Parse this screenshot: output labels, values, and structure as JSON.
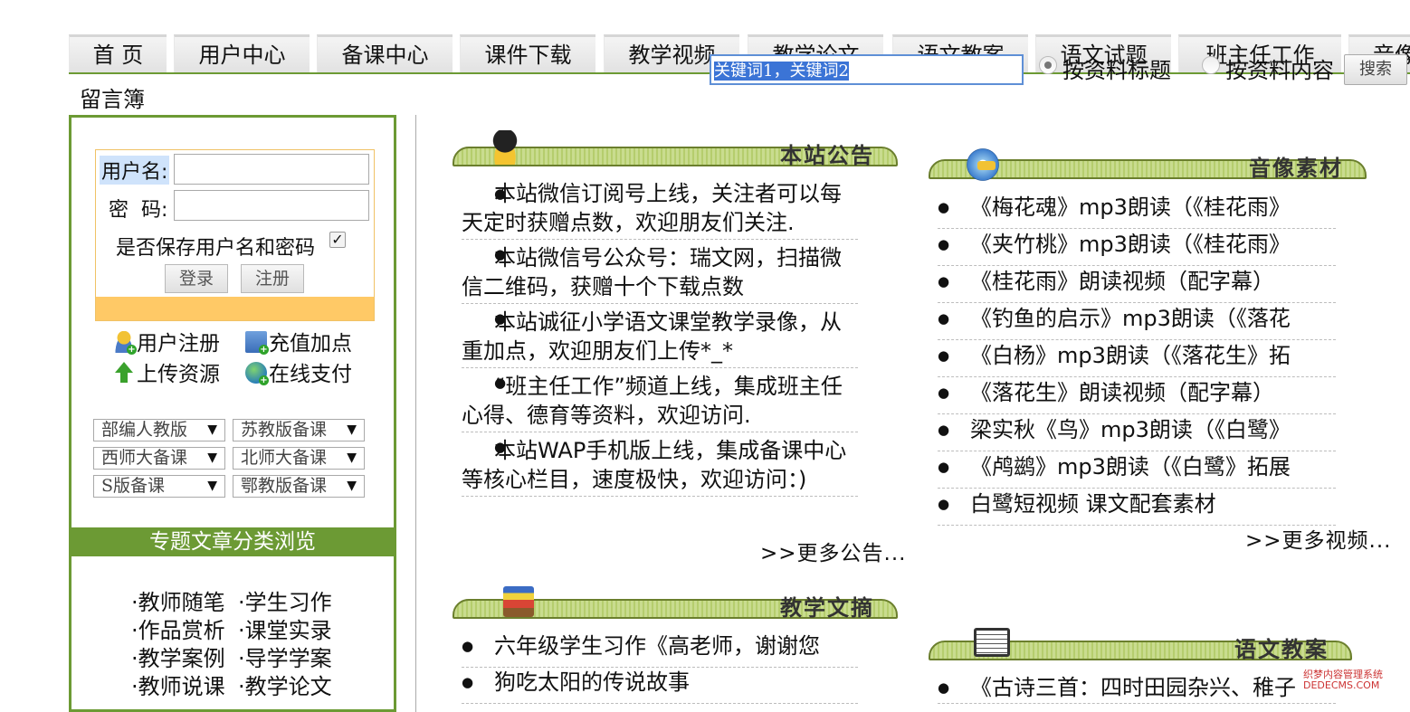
{
  "nav": {
    "tabs": [
      "首 页",
      "用户中心",
      "备课中心",
      "课件下载",
      "教学视频",
      "教学论文",
      "语文教案",
      "语文试题",
      "班主任工作",
      "音像"
    ],
    "guestbook": "留言簿"
  },
  "search": {
    "value": "关键词1，关键词2",
    "option_title": "按资料标题",
    "option_content": "按资料内容",
    "button": "搜索",
    "selected": "option_title"
  },
  "login": {
    "username_label": "用户名:",
    "password_label": "密  码:",
    "remember_label": "是否保存用户名和密码",
    "remember_checked": true,
    "login_button": "登录",
    "register_button": "注册"
  },
  "quick_links": {
    "register": "用户注册",
    "recharge": "充值加点",
    "upload": "上传资源",
    "pay": "在线支付"
  },
  "dropdowns": [
    "部编人教版",
    "苏教版备课",
    "西师大备课",
    "北师大备课",
    "S版备课",
    "鄂教版备课"
  ],
  "category": {
    "title": "专题文章分类浏览",
    "links": [
      "·教师随笔",
      "·学生习作",
      "·作品赏析",
      "·课堂实录",
      "·教学案例",
      "·导学学案",
      "·教师说课",
      "·教学论文"
    ]
  },
  "announcements": {
    "title": "本站公告",
    "items": [
      "本站微信订阅号上线，关注者可以每天定时获赠点数，欢迎朋友们关注.",
      "本站微信号公众号：瑞文网，扫描微信二维码，获赠十个下载点数",
      "本站诚征小学语文课堂教学录像，从重加点，欢迎朋友们上传*_*",
      "“班主任工作”频道上线，集成班主任心得、德育等资料，欢迎访问.",
      "本站WAP手机版上线，集成备课中心等核心栏目，速度极快，欢迎访问：)"
    ],
    "more": ">>更多公告..."
  },
  "media": {
    "title": "音像素材",
    "items": [
      "《梅花魂》mp3朗读（《桂花雨》",
      "《夹竹桃》mp3朗读（《桂花雨》",
      "《桂花雨》朗读视频（配字幕）",
      "《钓鱼的启示》mp3朗读（《落花",
      "《白杨》mp3朗读（《落花生》拓",
      "《落花生》朗读视频（配字幕）",
      "梁实秋《鸟》mp3朗读（《白鹭》",
      "《鸬鹚》mp3朗读（《白鹭》拓展",
      "白鹭短视频 课文配套素材"
    ],
    "more": ">>更多视频..."
  },
  "digest": {
    "title": "教学文摘",
    "items": [
      "六年级学生习作《高老师，谢谢您",
      "狗吃太阳的传说故事"
    ]
  },
  "lesson_plans": {
    "title": "语文教案",
    "items": [
      "《古诗三首：四时田园杂兴、稚子"
    ]
  },
  "watermark": [
    "织梦内容管理系统",
    "DEDECMS.COM"
  ]
}
